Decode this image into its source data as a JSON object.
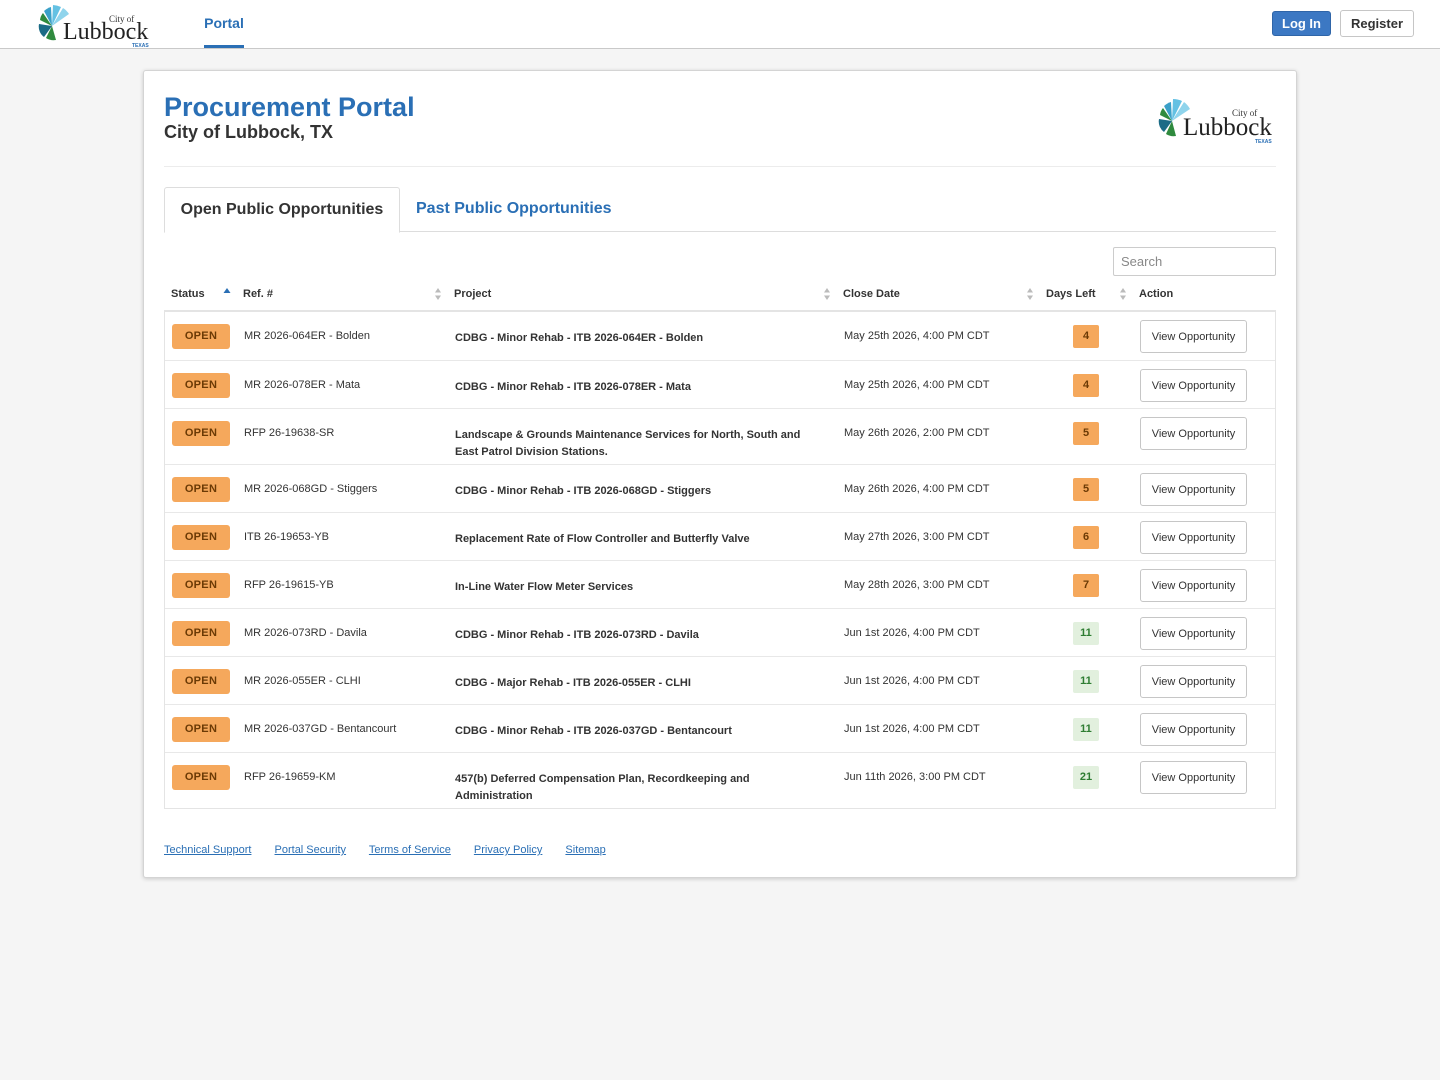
{
  "topbar": {
    "logo_text": "City of Lubbock TEXAS",
    "portal_tab": "Portal",
    "login_label": "Log In",
    "register_label": "Register"
  },
  "page": {
    "title": "Procurement Portal",
    "subtitle": "City of Lubbock, TX",
    "logo_text": "City of Lubbock TEXAS"
  },
  "tabs": {
    "open": "Open Public Opportunities",
    "past": "Past Public Opportunities"
  },
  "search": {
    "placeholder": "Search"
  },
  "table": {
    "headers": {
      "status": "Status",
      "ref": "Ref. #",
      "project": "Project",
      "close_date": "Close Date",
      "days_left": "Days Left",
      "action": "Action"
    },
    "rows": [
      {
        "status": "OPEN",
        "ref": "MR 2026-064ER - Bolden",
        "project": "CDBG - Minor Rehab - ITB 2026-064ER - Bolden",
        "close_date": "May 25th 2026, 4:00 PM CDT",
        "days_left": "4",
        "days_status": "warn",
        "action": "View Opportunity"
      },
      {
        "status": "OPEN",
        "ref": "MR 2026-078ER - Mata",
        "project": "CDBG - Minor Rehab - ITB 2026-078ER - Mata",
        "close_date": "May 25th 2026, 4:00 PM CDT",
        "days_left": "4",
        "days_status": "warn",
        "action": "View Opportunity"
      },
      {
        "status": "OPEN",
        "ref": "RFP 26-19638-SR",
        "project": "Landscape & Grounds Maintenance Services for North, South and East Patrol Division Stations.",
        "close_date": "May 26th 2026, 2:00 PM CDT",
        "days_left": "5",
        "days_status": "warn",
        "action": "View Opportunity"
      },
      {
        "status": "OPEN",
        "ref": "MR 2026-068GD - Stiggers",
        "project": "CDBG - Minor Rehab - ITB 2026-068GD - Stiggers",
        "close_date": "May 26th 2026, 4:00 PM CDT",
        "days_left": "5",
        "days_status": "warn",
        "action": "View Opportunity"
      },
      {
        "status": "OPEN",
        "ref": "ITB 26-19653-YB",
        "project": "Replacement Rate of Flow Controller and Butterfly Valve",
        "close_date": "May 27th 2026, 3:00 PM CDT",
        "days_left": "6",
        "days_status": "warn",
        "action": "View Opportunity"
      },
      {
        "status": "OPEN",
        "ref": "RFP 26-19615-YB",
        "project": "In-Line Water Flow Meter Services",
        "close_date": "May 28th 2026, 3:00 PM CDT",
        "days_left": "7",
        "days_status": "warn",
        "action": "View Opportunity"
      },
      {
        "status": "OPEN",
        "ref": "MR 2026-073RD - Davila",
        "project": "CDBG - Minor Rehab - ITB 2026-073RD - Davila",
        "close_date": "Jun 1st 2026, 4:00 PM CDT",
        "days_left": "11",
        "days_status": "ok",
        "action": "View Opportunity"
      },
      {
        "status": "OPEN",
        "ref": "MR 2026-055ER - CLHI",
        "project": "CDBG - Major Rehab - ITB 2026-055ER - CLHI",
        "close_date": "Jun 1st 2026, 4:00 PM CDT",
        "days_left": "11",
        "days_status": "ok",
        "action": "View Opportunity"
      },
      {
        "status": "OPEN",
        "ref": "MR 2026-037GD - Bentancourt",
        "project": "CDBG - Minor Rehab - ITB 2026-037GD - Bentancourt",
        "close_date": "Jun 1st 2026, 4:00 PM CDT",
        "days_left": "11",
        "days_status": "ok",
        "action": "View Opportunity"
      },
      {
        "status": "OPEN",
        "ref": "RFP 26-19659-KM",
        "project": "457(b) Deferred Compensation Plan, Recordkeeping and Administration",
        "close_date": "Jun 11th 2026, 3:00 PM CDT",
        "days_left": "21",
        "days_status": "ok",
        "action": "View Opportunity"
      }
    ]
  },
  "footer": {
    "links": [
      "Technical Support",
      "Portal Security",
      "Terms of Service",
      "Privacy Policy",
      "Sitemap"
    ]
  },
  "colors": {
    "brand_blue": "#2a6fb5",
    "open_badge": "#f5a85c",
    "days_ok": "#e2f0de",
    "login_button": "#3c78c3"
  }
}
